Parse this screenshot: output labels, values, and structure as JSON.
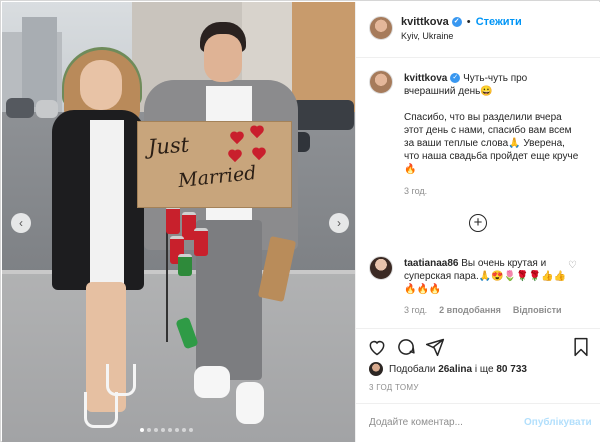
{
  "post": {
    "username": "kvittkova",
    "follow_label": "Стежити",
    "location": "Kyiv, Ukraine",
    "sign_line1": "Just",
    "sign_line2": "Married",
    "carousel_dot_count": 8,
    "carousel_active_index": 0
  },
  "caption": {
    "username": "kvittkova",
    "line1": "Чуть-чуть про вчерашний день😀",
    "body": "Спасибо, что вы разделили вчера этот день с нами, спасибо вам всем за ваши теплые слова🙏 Уверена, что наша свадьба пройдет еще круче🔥",
    "time": "3 год."
  },
  "more_comments_label": "+",
  "comment": {
    "username": "taatianaa86",
    "text": "Вы очень крутая и суперская пара.🙏😍🌷🌹🌹👍👍🔥🔥🔥",
    "time": "3 год.",
    "likes": "2 вподобання",
    "reply": "Відповісти"
  },
  "likes": {
    "prefix": "Подобали",
    "user": "26alina",
    "middle": "і ще",
    "count": "80 733"
  },
  "posted_ago": "3 ГОД ТОМУ",
  "comment_box": {
    "placeholder": "Додайте коментар...",
    "publish_label": "Опублікувати"
  },
  "colors": {
    "accent": "#0095f6",
    "publish_disabled": "#b2dffc",
    "muted": "#8e8e8e",
    "heart_red": "#c91f2d",
    "sign_cardboard": "#c8a57c"
  },
  "icons": [
    "verified-badge-icon",
    "heart-outline-icon",
    "comment-icon",
    "share-icon",
    "bookmark-icon",
    "plus-circle-icon",
    "chevron-left-icon",
    "chevron-right-icon"
  ]
}
